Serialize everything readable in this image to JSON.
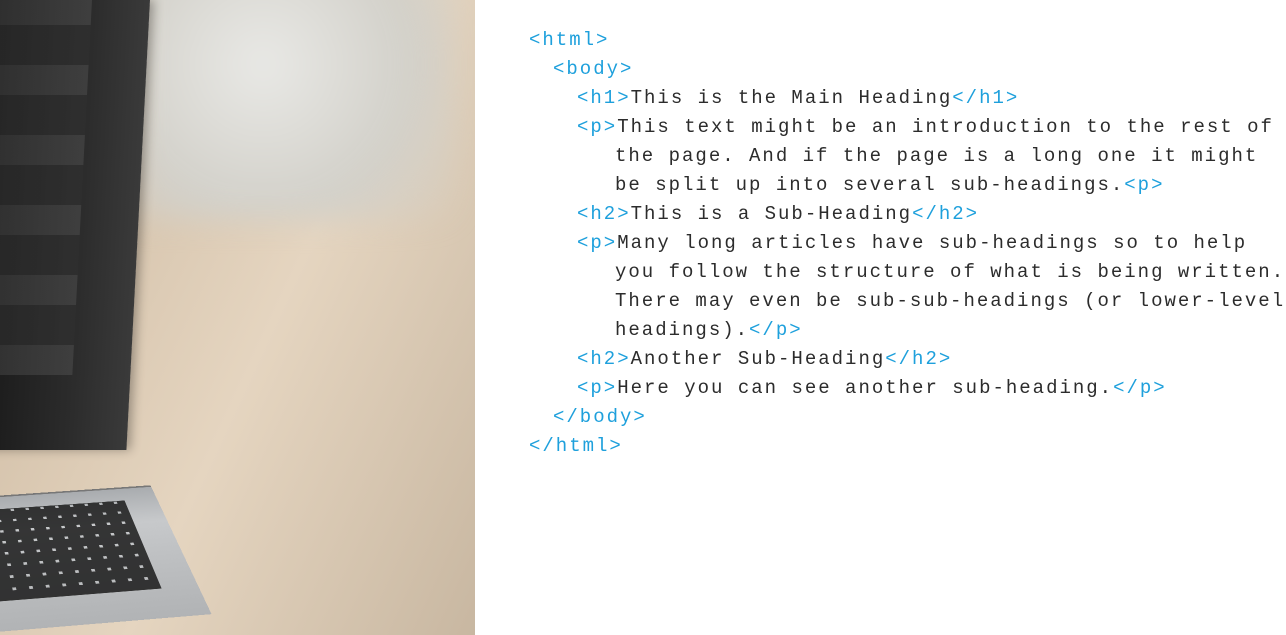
{
  "code": {
    "lines": [
      {
        "indent": "",
        "parts": [
          {
            "type": "tag",
            "text": "<html>"
          }
        ]
      },
      {
        "indent": "i1",
        "parts": [
          {
            "type": "tag",
            "text": "<body>"
          }
        ]
      },
      {
        "indent": "i2",
        "parts": [
          {
            "type": "tag",
            "text": "<h1>"
          },
          {
            "type": "txt",
            "text": "This is the Main Heading"
          },
          {
            "type": "tag",
            "text": "</h1>"
          }
        ]
      },
      {
        "indent": "i2",
        "parts": [
          {
            "type": "tag",
            "text": "<p>"
          },
          {
            "type": "txt",
            "text": "This text might be an introduction to the rest of"
          }
        ]
      },
      {
        "indent": "i3",
        "parts": [
          {
            "type": "txt",
            "text": "the page. And if the page is a long one it might"
          }
        ]
      },
      {
        "indent": "i3",
        "parts": [
          {
            "type": "txt",
            "text": "be split up into several sub-headings."
          },
          {
            "type": "tag",
            "text": "<p>"
          }
        ]
      },
      {
        "indent": "i2",
        "parts": [
          {
            "type": "tag",
            "text": "<h2>"
          },
          {
            "type": "txt",
            "text": "This is a Sub-Heading"
          },
          {
            "type": "tag",
            "text": "</h2>"
          }
        ]
      },
      {
        "indent": "i2",
        "parts": [
          {
            "type": "tag",
            "text": "<p>"
          },
          {
            "type": "txt",
            "text": "Many long articles have sub-headings so to help"
          }
        ]
      },
      {
        "indent": "i3",
        "parts": [
          {
            "type": "txt",
            "text": "you follow the structure of what is being written."
          }
        ]
      },
      {
        "indent": "i3",
        "parts": [
          {
            "type": "txt",
            "text": "There may even be sub-sub-headings (or lower-level"
          }
        ]
      },
      {
        "indent": "i3",
        "parts": [
          {
            "type": "txt",
            "text": "headings)."
          },
          {
            "type": "tag",
            "text": "</p>"
          }
        ]
      },
      {
        "indent": "i2",
        "parts": [
          {
            "type": "tag",
            "text": "<h2>"
          },
          {
            "type": "txt",
            "text": "Another Sub-Heading"
          },
          {
            "type": "tag",
            "text": "</h2>"
          }
        ]
      },
      {
        "indent": "i2",
        "parts": [
          {
            "type": "tag",
            "text": "<p>"
          },
          {
            "type": "txt",
            "text": "Here you can see another sub-heading."
          },
          {
            "type": "tag",
            "text": "</p>"
          }
        ]
      },
      {
        "indent": "i1",
        "parts": [
          {
            "type": "tag",
            "text": "</body>"
          }
        ]
      },
      {
        "indent": "",
        "parts": [
          {
            "type": "tag",
            "text": "</html>"
          }
        ]
      }
    ]
  }
}
